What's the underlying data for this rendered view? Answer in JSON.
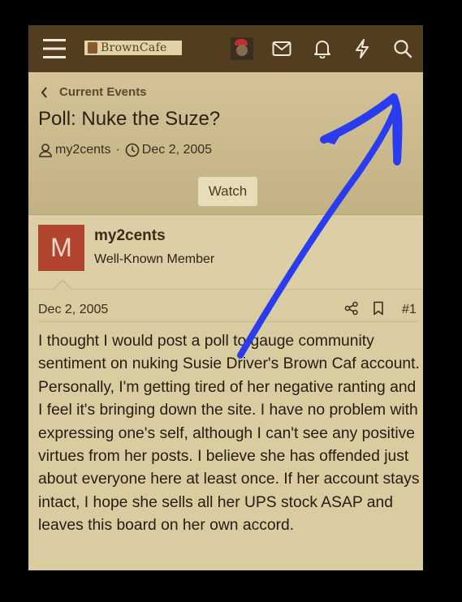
{
  "header": {
    "logo_text": "BrownCafe",
    "icons": [
      "menu-icon",
      "avatar",
      "mail-icon",
      "bell-icon",
      "bolt-icon",
      "search-icon"
    ]
  },
  "breadcrumb": {
    "label": "Current Events"
  },
  "thread": {
    "title": "Poll: Nuke the Suze?",
    "author": "my2cents",
    "separator": "·",
    "date": "Dec 2, 2005",
    "watch_label": "Watch"
  },
  "post": {
    "avatar_letter": "M",
    "username": "my2cents",
    "user_title": "Well-Known Member",
    "date": "Dec 2, 2005",
    "number": "#1",
    "body": "I thought I would post a poll to gauge community sentiment on nuking Susie Driver's Brown Caf account. Personally, I'm getting tired of her negative ranting and I feel it's bringing down the site. I have no problem with expressing one's self, although I can't see any positive virtues from her posts. I believe she has offended just about everyone here at least once. If her account stays intact, I hope she sells all her UPS stock ASAP and leaves this board on her own accord."
  },
  "colors": {
    "topbar": "#523e1f",
    "content_bg": "#d9cca0",
    "avatar_bg": "#b0442e",
    "annotation_stroke": "#2a3cf0"
  }
}
